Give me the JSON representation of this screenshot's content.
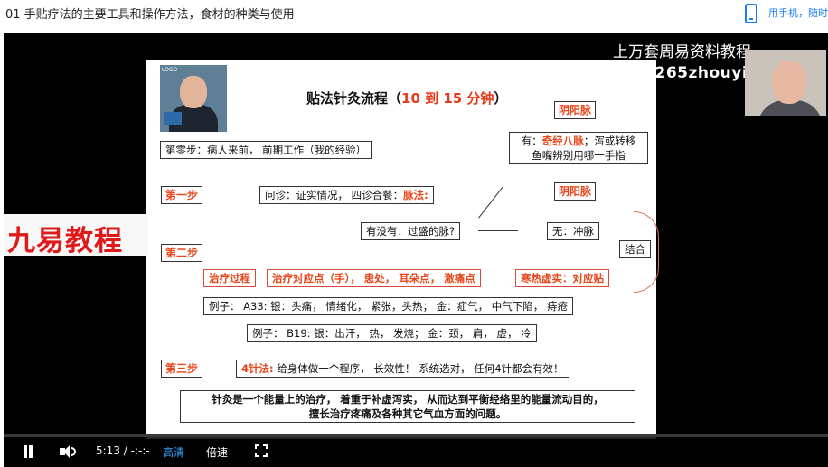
{
  "header": {
    "title": "01 手贴疗法的主要工具和操作方法，食材的种类与使用",
    "phone_link": "用手机，随时"
  },
  "overlay": {
    "watermark_line1": "上万套周易资料教程",
    "watermark_line2": "www.265zhouyiw.com",
    "brand_text": "九易教程"
  },
  "slide": {
    "logo_label": "LOGO",
    "title_prefix": "贴法针灸流程（",
    "title_highlight": "10 到 15 分钟",
    "title_suffix": "）",
    "step0": "第零步：病人来前， 前期工作（我的经验）",
    "step1_label": "第一步",
    "step1_text": "问诊：证实情况， 四诊合餐：",
    "step1_highlight": "脉法:",
    "yinyang_top": "阴阳脉",
    "yinyang_mid": "阴阳脉",
    "has_prefix": "有：",
    "has_highlight": "奇经八脉",
    "has_suffix": "；泻或转移",
    "has_line2": "鱼嘴辨别用哪一手指",
    "question": "有没有：过盛的脉?",
    "none": "无：冲脉",
    "combine": "结合",
    "step2_label": "第二步",
    "treat_process": "治疗过程",
    "treat_points": "治疗对应点（手）， 患处， 耳朵点， 激痛点",
    "cold_heat": "寒热虚实：对应贴",
    "example_a33": "例子：  A33: 银：头痛， 情绪化， 紧张，头热； 金：疝气， 中气下陷， 痔疮",
    "example_b19": "例子：  B19: 银：出汗， 热， 发烧； 金：颈， 肩， 虚， 冷",
    "step3_label": "第三步",
    "four_needle_label": "4针法:",
    "four_needle_text": "  给身体做一个程序， 长效性！ 系统选对， 任何4针都会有效！",
    "summary_line1": "针灸是一个能量上的治疗， 着重于补虚泻实， 从而达到平衡经络里的能量流动目的，",
    "summary_line2": "擅长治疗疼痛及各种其它气血方面的问题。"
  },
  "player": {
    "time": "5:13 / -:-:-",
    "quality": "高清",
    "speed": "倍速",
    "progress": 0.0
  },
  "colors": {
    "accent": "#1a7ef2",
    "highlight_red": "#e8461a"
  }
}
